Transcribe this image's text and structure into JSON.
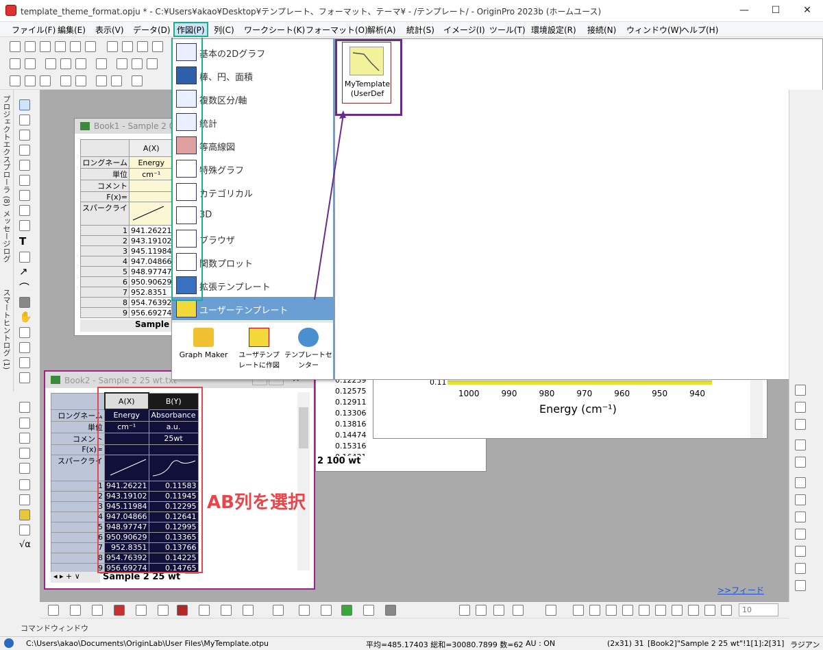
{
  "window": {
    "title": "template_theme_format.opju * - C:¥Users¥akao¥Desktop¥テンプレート、フォーマット、テーマ¥ - /テンプレート/ - OriginPro 2023b (ホームユース)",
    "min": "—",
    "max": "☐",
    "close": "✕"
  },
  "menubar": [
    "ファイル(F)",
    "編集(E)",
    "表示(V)",
    "データ(D)",
    "作図(P)",
    "列(C)",
    "ワークシート(K)",
    "フォーマット(O)",
    "解析(A)",
    "統計(S)",
    "イメージ(I)",
    "ツール(T)",
    "環境設定(R)",
    "接続(N)",
    "ウィンドウ(W)",
    "ヘルプ(H)"
  ],
  "leftpanel": {
    "project_explorer": "プロジェクトエクスプローラ (8)",
    "message_log": "メッセージログ",
    "smart_hint": "スマートヒントログ (1)"
  },
  "plot_menu": {
    "items": [
      "基本の2Dグラフ",
      "棒、円、面積",
      "複数区分/軸",
      "統計",
      "等高線図",
      "特殊グラフ",
      "カテゴリカル",
      "3D",
      "ブラウザ",
      "関数プロット",
      "拡張テンプレート",
      "ユーザーテンプレート"
    ],
    "bottom": [
      "Graph Maker",
      "ユーザテンプレートに作図",
      "テンプレートセンター"
    ]
  },
  "submenu": {
    "template_label_line1": "MyTemplate",
    "template_label_line2": "(UserDef"
  },
  "book1": {
    "title": "Book1 - Sample 2 0 w",
    "col_a": "A(X)",
    "labels": [
      "ロングネーム",
      "単位",
      "コメント",
      "F(x)=",
      "スパークライ"
    ],
    "longname": "Energy",
    "unit": "cm⁻¹",
    "rows": [
      "1",
      "2",
      "3",
      "4",
      "5",
      "6",
      "7",
      "8",
      "9"
    ],
    "values": [
      "941.26221",
      "943.19102",
      "945.11984",
      "947.04866",
      "948.97747",
      "950.90629",
      "952.8351",
      "954.76392",
      "956.69274"
    ],
    "sheet_tab": "Sample"
  },
  "book2": {
    "title": "Book2 - Sample 2 25 wt.txt",
    "col_a": "A(X)",
    "col_b": "B(Y)",
    "labels": [
      "ロングネーム",
      "単位",
      "コメント",
      "F(x)=",
      "スパークライ"
    ],
    "longname_a": "Energy",
    "longname_b": "Absorbance",
    "unit_a": "cm⁻¹",
    "unit_b": "a.u.",
    "comment_b": "25wt",
    "rows": [
      "1",
      "2",
      "3",
      "4",
      "5",
      "6",
      "7",
      "8",
      "9"
    ],
    "values_a": [
      "941.26221",
      "943.19102",
      "945.11984",
      "947.04866",
      "948.97747",
      "950.90629",
      "952.8351",
      "954.76392",
      "956.69274"
    ],
    "values_b": [
      "0.11583",
      "0.11945",
      "0.12295",
      "0.12641",
      "0.12995",
      "0.13365",
      "0.13766",
      "0.14225",
      "0.14765"
    ],
    "sheet_tab": "Sample 2 25 wt"
  },
  "book3": {
    "values": [
      "0.12239",
      "0.12575",
      "0.12911",
      "0.13306",
      "0.13816",
      "0.14474",
      "0.15316",
      "0.16421"
    ],
    "sheet_tab": "2 100 wt"
  },
  "graph": {
    "xticks": [
      "1000",
      "990",
      "980",
      "970",
      "960",
      "950",
      "940"
    ],
    "ytick": "0.11",
    "xlabel": "Energy (cm⁻¹)"
  },
  "annotation": "AB列を選択",
  "feed_link": ">>フィード",
  "command_window": "コマンドウィンドウ",
  "zoom_value": "10",
  "statusbar": {
    "path": "C:\\Users\\akao\\Documents\\OriginLab\\User Files\\MyTemplate.otpu",
    "stats": "平均=485.17403 総和=30080.7899 数=62",
    "au": "AU : ON",
    "dims": "(2x31) 31",
    "range": "[Book2]\"Sample 2 25 wt\"!1[1]:2[31]",
    "unit": "ラジアン"
  },
  "colors": {
    "accent_blue": "#6a9fd4",
    "highlight_green": "#1aaf8c",
    "highlight_purple": "#6b2a8e",
    "annotation_red": "#e8454a",
    "book2_border": "#a0208c"
  }
}
